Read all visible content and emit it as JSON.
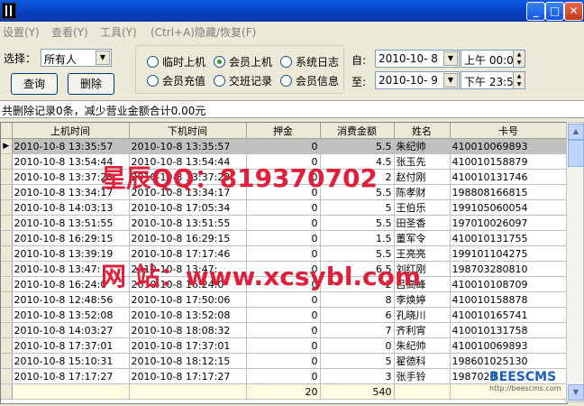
{
  "menu": [
    "设置(Y)",
    "查看(Y)",
    "工具(Y)",
    "(Ctrl+A)隐藏/恢复(F)"
  ],
  "filter": {
    "select_label": "选择：",
    "select_value": "所有人",
    "query_button": "查询",
    "delete_button": "删除"
  },
  "radios": [
    {
      "label": "临时上机",
      "checked": false
    },
    {
      "label": "会员上机",
      "checked": true
    },
    {
      "label": "系统日志",
      "checked": false
    },
    {
      "label": "会员充值",
      "checked": false
    },
    {
      "label": "交班记录",
      "checked": false
    },
    {
      "label": "会员信息",
      "checked": false
    }
  ],
  "date_range": {
    "from_label": "自:",
    "from_date": "2010-10- 8",
    "from_time": "上午 00:0",
    "to_label": "至:",
    "to_date": "2010-10- 9",
    "to_time": "下午 23:5"
  },
  "status_text": "共删除记录0条，减少营业金额合计0.00元",
  "table": {
    "columns": [
      "上机时间",
      "下机时间",
      "押金",
      "消费金额",
      "姓名",
      "卡号"
    ],
    "rows": [
      [
        "2010-10-8 13:35:57",
        "2010-10-8 13:35:57",
        "0",
        "5.5",
        "朱纪帅",
        "410010069893"
      ],
      [
        "2010-10-8 13:54:44",
        "2010-10-8 13:54:44",
        "0",
        "4.5",
        "张玉先",
        "410010158879"
      ],
      [
        "2010-10-8 13:37:23",
        "2010-10-8 13:37:23",
        "0",
        "2",
        "赵付刚",
        "410010131746"
      ],
      [
        "2010-10-8 13:34:17",
        "2010-10-8 13:34:17",
        "0",
        "5.5",
        "陈孝财",
        "198808166815"
      ],
      [
        "2010-10-8 14:03:13",
        "2010-10-8 17:05:34",
        "0",
        "5",
        "王伯乐",
        "199105060054"
      ],
      [
        "2010-10-8 13:51:55",
        "2010-10-8 13:51:55",
        "0",
        "5.5",
        "田圣香",
        "197010026097"
      ],
      [
        "2010-10-8 16:29:15",
        "2010-10-8 16:29:15",
        "0",
        "1.5",
        "董军令",
        "410010131755"
      ],
      [
        "2010-10-8 13:39:19",
        "2010-10-8 17:17:46",
        "0",
        "5.5",
        "王亮亮",
        "199101104275"
      ],
      [
        "2010-10-8 13:47:",
        "2010-10-8 13:47:",
        "0",
        "6.5",
        "刘红刚",
        "198703280810"
      ],
      [
        "2010-10-8 16:24:0",
        "2010-10-8 16:24:0",
        "0",
        "2",
        "吕高峰",
        "410010108709"
      ],
      [
        "2010-10-8 12:48:56",
        "2010-10-8 17:50:06",
        "0",
        "8",
        "李焕婷",
        "410010158878"
      ],
      [
        "2010-10-8 13:52:08",
        "2010-10-8 13:52:08",
        "0",
        "6",
        "孔晓川",
        "410010165741"
      ],
      [
        "2010-10-8 14:03:27",
        "2010-10-8 18:08:32",
        "0",
        "7",
        "齐利宵",
        "410010131758"
      ],
      [
        "2010-10-8 17:37:01",
        "2010-10-8 17:37:01",
        "0",
        "0",
        "朱纪帅",
        "410010069893"
      ],
      [
        "2010-10-8 15:10:31",
        "2010-10-8 18:12:15",
        "0",
        "5",
        "翟德科",
        "198601025130"
      ],
      [
        "2010-10-8 17:17:27",
        "2010-10-8 17:17:27",
        "0",
        "3",
        "张手铃",
        "1987020"
      ]
    ],
    "totals": {
      "deposit": "20",
      "amount": "540"
    }
  },
  "watermarks": [
    "星辰QQ：819370702",
    "网 站：www.xcsybl.com"
  ],
  "brand": {
    "logo": "BEESCMS",
    "url": "http://beescms.com"
  }
}
